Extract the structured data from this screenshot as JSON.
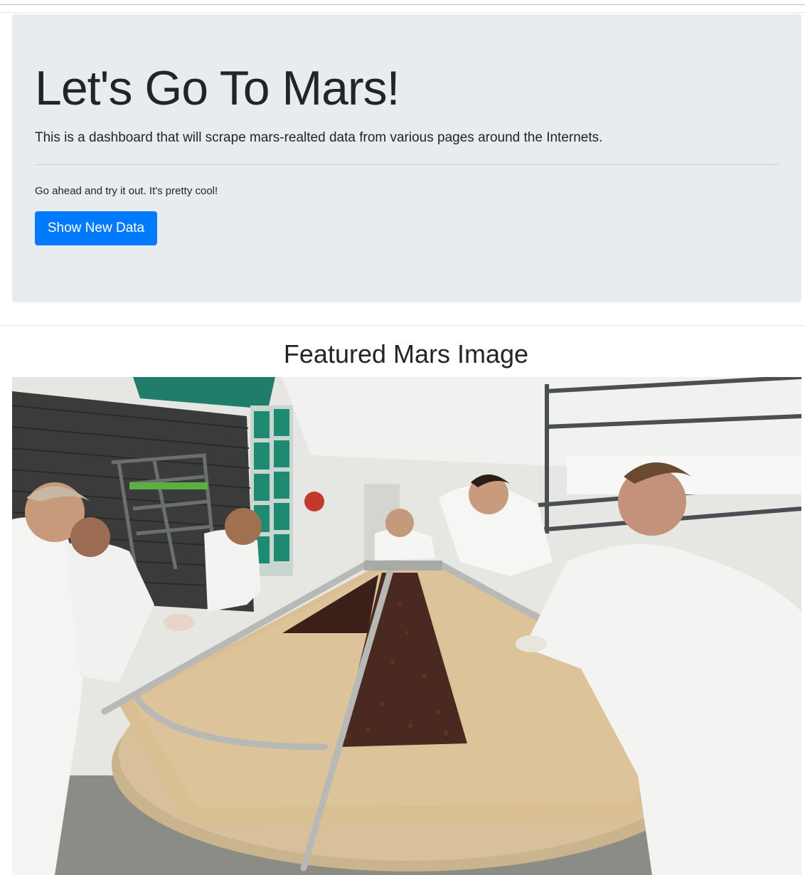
{
  "jumbotron": {
    "title": "Let's Go To Mars!",
    "lead": "This is a dashboard that will scrape mars-realted data from various pages around the Internets.",
    "subtext": "Go ahead and try it out. It's pretty cool!",
    "button_label": "Show New Data"
  },
  "featured": {
    "heading": "Featured Mars Image"
  },
  "colors": {
    "jumbotron_bg": "#e9ecef",
    "primary": "#007bff"
  }
}
